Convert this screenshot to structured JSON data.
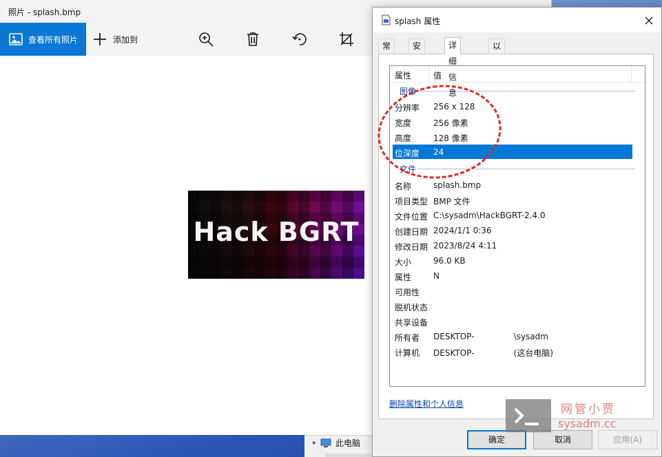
{
  "photos": {
    "title": "照片 - splash.bmp",
    "view_all_label": "查看所有照片",
    "add_to_label": "添加到",
    "image_text": "Hack BGRT"
  },
  "explorer": {
    "item_label": "此电脑"
  },
  "dialog": {
    "title": "splash 属性",
    "tabs": [
      "常规",
      "安全",
      "详细信息",
      "以前的版本"
    ],
    "active_tab": "详细信息",
    "columns": {
      "property": "属性",
      "value": "值"
    },
    "groups": {
      "image": "图像",
      "file": "文件"
    },
    "image_rows": [
      {
        "k": "分辨率",
        "v": "256 x 128"
      },
      {
        "k": "宽度",
        "v": "256 像素"
      },
      {
        "k": "高度",
        "v": "128 像素"
      },
      {
        "k": "位深度",
        "v": "24"
      }
    ],
    "file_rows": [
      {
        "k": "名称",
        "v": "splash.bmp"
      },
      {
        "k": "项目类型",
        "v": "BMP 文件"
      },
      {
        "k": "文件位置",
        "v": "C:\\sysadm\\HackBGRT-2.4.0"
      },
      {
        "k": "创建日期",
        "v": "2024/1/1 0:36"
      },
      {
        "k": "修改日期",
        "v": "2023/8/24 4:11"
      },
      {
        "k": "大小",
        "v": "96.0 KB"
      },
      {
        "k": "属性",
        "v": "N"
      },
      {
        "k": "可用性",
        "v": ""
      },
      {
        "k": "脱机状态",
        "v": ""
      },
      {
        "k": "共享设备",
        "v": ""
      },
      {
        "k": "所有者",
        "v": "DESKTOP-               \\sysadm"
      },
      {
        "k": "计算机",
        "v": "DESKTOP-               (这台电脑)"
      }
    ],
    "remove_link": "删除属性和个人信息",
    "ok_label": "确定",
    "cancel_label": "取消",
    "apply_label": "应用(A)"
  },
  "watermark": {
    "title": "网管小贾",
    "url": "sysadm.cc"
  },
  "colors": {
    "accent": "#0a78d4",
    "selection": "#0078d7",
    "annotation": "#e0281f"
  }
}
